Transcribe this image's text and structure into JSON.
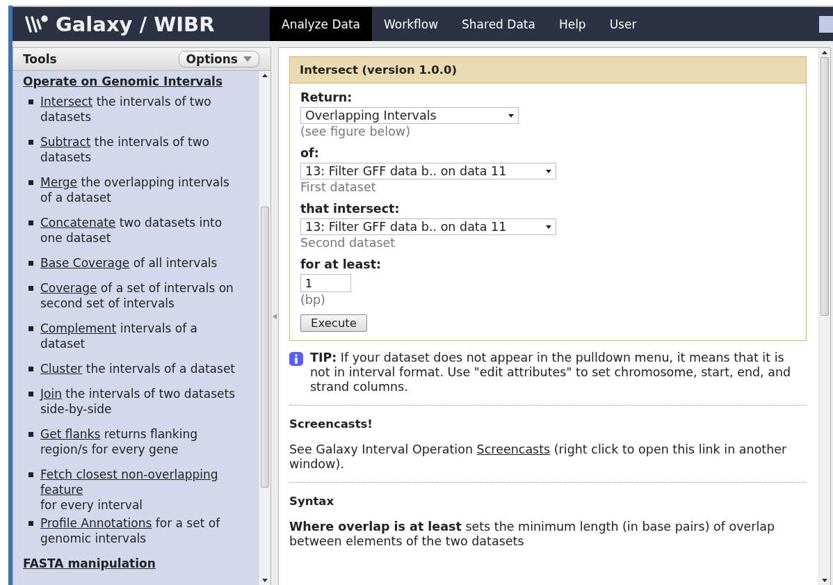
{
  "masthead": {
    "brand": "Galaxy / WIBR",
    "tabs": [
      {
        "label": "Analyze Data",
        "selected": true
      },
      {
        "label": "Workflow",
        "selected": false
      },
      {
        "label": "Shared Data",
        "selected": false
      },
      {
        "label": "Help",
        "selected": false
      },
      {
        "label": "User",
        "selected": false
      }
    ]
  },
  "tools": {
    "title": "Tools",
    "options": "Options",
    "sections": [
      {
        "title": "Operate on Genomic Intervals",
        "items": [
          {
            "link": "Intersect",
            "rest": "the intervals of two datasets"
          },
          {
            "link": "Subtract",
            "rest": "the intervals of two datasets"
          },
          {
            "link": "Merge",
            "rest": "the overlapping intervals of a dataset"
          },
          {
            "link": "Concatenate",
            "rest": "two datasets into one dataset"
          },
          {
            "link": "Base Coverage",
            "rest": "of all intervals"
          },
          {
            "link": "Coverage",
            "rest": "of a set of intervals on second set of intervals"
          },
          {
            "link": "Complement",
            "rest": "intervals of a dataset"
          },
          {
            "link": "Cluster",
            "rest": "the intervals of a dataset"
          },
          {
            "link": "Join",
            "rest": "the intervals of two datasets side-by-side"
          },
          {
            "link": "Get flanks",
            "rest": "returns flanking region/s for every gene"
          },
          {
            "link": "Fetch closest non-overlapping feature",
            "rest": "for every interval"
          },
          {
            "link": "Profile Annotations",
            "rest": "for a set of genomic intervals"
          }
        ]
      },
      {
        "title": "FASTA manipulation"
      }
    ]
  },
  "form": {
    "title": "Intersect (version 1.0.0)",
    "fields": [
      {
        "kind": "select",
        "label": "Return:",
        "value": "Overlapping Intervals",
        "help": "(see figure below)"
      },
      {
        "kind": "select",
        "label": "of:",
        "value": "13: Filter GFF data b.. on data 11",
        "help": "First dataset"
      },
      {
        "kind": "select",
        "label": "that intersect:",
        "value": "13: Filter GFF data b.. on data 11",
        "help": "Second dataset"
      },
      {
        "kind": "input",
        "label": "for at least:",
        "value": "1",
        "help": "(bp)"
      }
    ],
    "submit": "Execute"
  },
  "tip": "**TIP:** If your dataset does not appear in the pulldown menu, it means that it is not in interval format. Use \"edit attributes\" to set chromosome, start, end, and strand columns.",
  "screencasts": {
    "heading": "Screencasts!",
    "before": "See Galaxy Interval Operation",
    "link": "Screencasts",
    "after": "(right click to open this link in another window)."
  },
  "syntax": {
    "heading": "Syntax",
    "text": "**Where overlap is at least** sets the minimum length (in base pairs) of overlap between elements of the two datasets"
  }
}
